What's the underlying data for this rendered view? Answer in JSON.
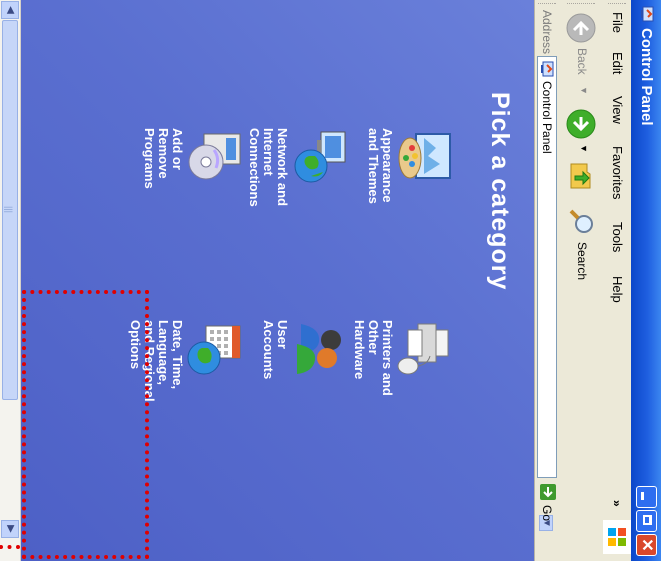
{
  "window": {
    "title": "Control Panel"
  },
  "menubar": {
    "items": [
      "File",
      "Edit",
      "View",
      "Favorites",
      "Tools",
      "Help"
    ],
    "overflow": "»"
  },
  "toolbar": {
    "back_label": "Back",
    "search_label": "Search"
  },
  "addressbar": {
    "label": "Address",
    "value": "Control Panel",
    "go_label": "Go"
  },
  "content": {
    "heading": "Pick a category",
    "categories": [
      {
        "label": "Appearance\nand Themes",
        "icon": "appearance-themes-icon"
      },
      {
        "label": "Printers and\nOther\nHardware",
        "icon": "printers-hardware-icon"
      },
      {
        "label": "Network and\nInternet\nConnections",
        "icon": "network-internet-icon"
      },
      {
        "label": "User\nAccounts",
        "icon": "user-accounts-icon"
      },
      {
        "label": "Add or\nRemove\nPrograms",
        "icon": "add-remove-programs-icon"
      },
      {
        "label": "Date, Time,\nLanguage,\nand Regional\nOptions",
        "icon": "date-time-language-icon"
      }
    ]
  },
  "colors": {
    "titlebar": "#1f5fe0",
    "panel_background": "#5a6fd0",
    "highlight": "#e00000",
    "menubar": "#ece9d8"
  }
}
